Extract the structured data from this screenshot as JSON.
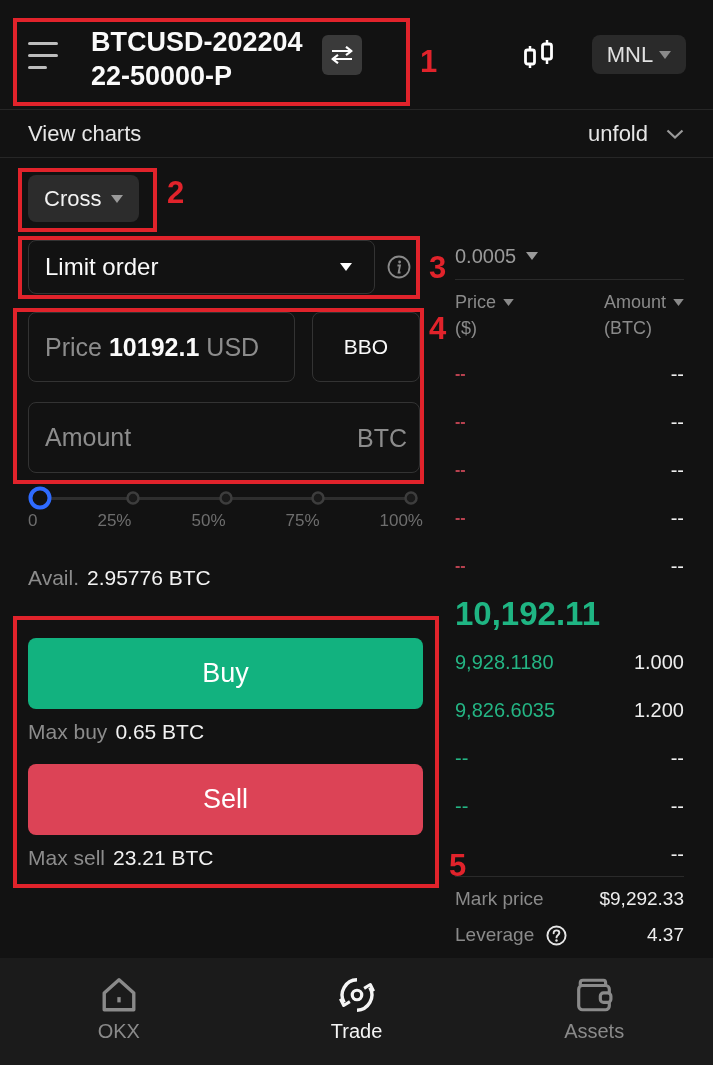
{
  "header": {
    "title": "BTCUSD-20220422-50000-P",
    "region": {
      "label": "MNL"
    }
  },
  "chart_bar": {
    "label": "View charts",
    "toggle": "unfold"
  },
  "margin_mode": {
    "label": "Cross"
  },
  "order_type": {
    "value": "Limit order"
  },
  "price_field": {
    "label": "Price",
    "value": "10192.1",
    "unit": "USD"
  },
  "bbo_button": {
    "label": "BBO"
  },
  "amount_field": {
    "placeholder": "Amount",
    "unit": "BTC"
  },
  "slider": {
    "level": 0,
    "stops": [
      "0",
      "25%",
      "50%",
      "75%",
      "100%"
    ]
  },
  "available": {
    "label": "Avail.",
    "value": "2.95776 BTC"
  },
  "actions": [
    {
      "kind": "buy",
      "label": "Buy",
      "max_label": "Max buy",
      "max_value": "0.65 BTC"
    },
    {
      "kind": "sell",
      "label": "Sell",
      "max_label": "Max sell",
      "max_value": "23.21 BTC"
    }
  ],
  "order_book": {
    "tick_size": "0.0005",
    "columns": [
      {
        "label": "Price",
        "unit": "($)"
      },
      {
        "label": "Amount",
        "unit": "(BTC)"
      }
    ],
    "asks": [
      {
        "price": "--",
        "amount": "--"
      },
      {
        "price": "--",
        "amount": "--"
      },
      {
        "price": "--",
        "amount": "--"
      },
      {
        "price": "--",
        "amount": "--"
      },
      {
        "price": "--",
        "amount": "--"
      }
    ],
    "last_price": "10,192.11",
    "bids": [
      {
        "price": "9,928.1180",
        "amount": "1.000"
      },
      {
        "price": "9,826.6035",
        "amount": "1.200"
      },
      {
        "price": "--",
        "amount": "--"
      },
      {
        "price": "--",
        "amount": "--"
      },
      {
        "amount": "--"
      }
    ]
  },
  "stats": [
    {
      "label": "Mark price",
      "value": "$9,292.33"
    },
    {
      "label": "Leverage",
      "value": "4.37",
      "help": true
    }
  ],
  "nav": [
    {
      "label": "OKX",
      "selected": false
    },
    {
      "label": "Trade",
      "selected": true
    },
    {
      "label": "Assets",
      "selected": false
    }
  ],
  "callouts": [
    {
      "label": "1"
    },
    {
      "label": "2"
    },
    {
      "label": "3"
    },
    {
      "label": "4"
    },
    {
      "label": "5"
    }
  ]
}
